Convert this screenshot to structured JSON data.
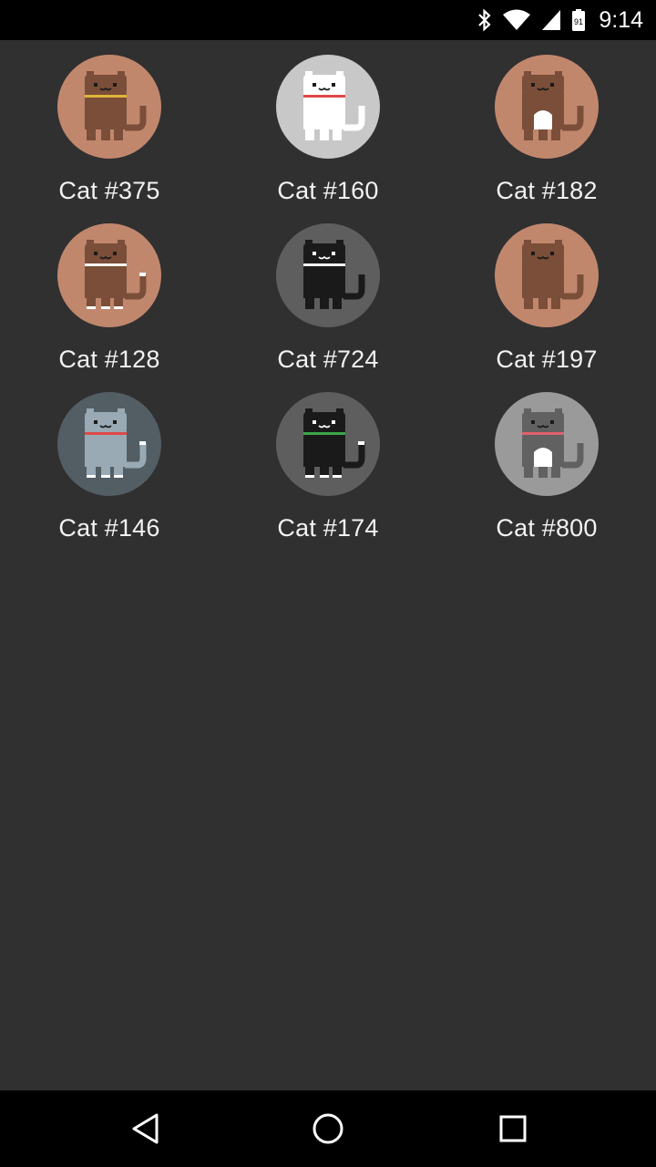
{
  "status_bar": {
    "time": "9:14",
    "icons": [
      "bluetooth-icon",
      "wifi-icon",
      "cell-signal-icon",
      "battery-icon"
    ],
    "battery_level": "91"
  },
  "cats": [
    {
      "name": "Cat #375",
      "bg": "#c1876d",
      "body": "#7a4e38",
      "collar": "#e0b53a",
      "belly": "",
      "socks": ""
    },
    {
      "name": "Cat #160",
      "bg": "#c8c8c8",
      "body": "#ffffff",
      "collar": "#e04848",
      "belly": "",
      "socks": ""
    },
    {
      "name": "Cat #182",
      "bg": "#c1876d",
      "body": "#7a4e38",
      "collar": "",
      "belly": "#ffffff",
      "socks": ""
    },
    {
      "name": "Cat #128",
      "bg": "#c1876d",
      "body": "#7a4e38",
      "collar": "#ffffff",
      "belly": "",
      "socks": "#ffffff"
    },
    {
      "name": "Cat #724",
      "bg": "#5e5e5e",
      "body": "#1a1a1a",
      "collar": "#ffffff",
      "belly": "",
      "socks": ""
    },
    {
      "name": "Cat #197",
      "bg": "#c1876d",
      "body": "#7a4e38",
      "collar": "",
      "belly": "",
      "socks": ""
    },
    {
      "name": "Cat #146",
      "bg": "#525d64",
      "body": "#9aaab4",
      "collar": "#e04848",
      "belly": "",
      "socks": "#ffffff"
    },
    {
      "name": "Cat #174",
      "bg": "#5e5e5e",
      "body": "#1a1a1a",
      "collar": "#3aa64a",
      "belly": "",
      "socks": "#ffffff"
    },
    {
      "name": "Cat #800",
      "bg": "#9a9a9a",
      "body": "#616161",
      "collar": "#e06070",
      "belly": "#ffffff",
      "socks": ""
    }
  ],
  "nav_bar": {
    "icons": [
      "back-icon",
      "home-icon",
      "recents-icon"
    ]
  }
}
